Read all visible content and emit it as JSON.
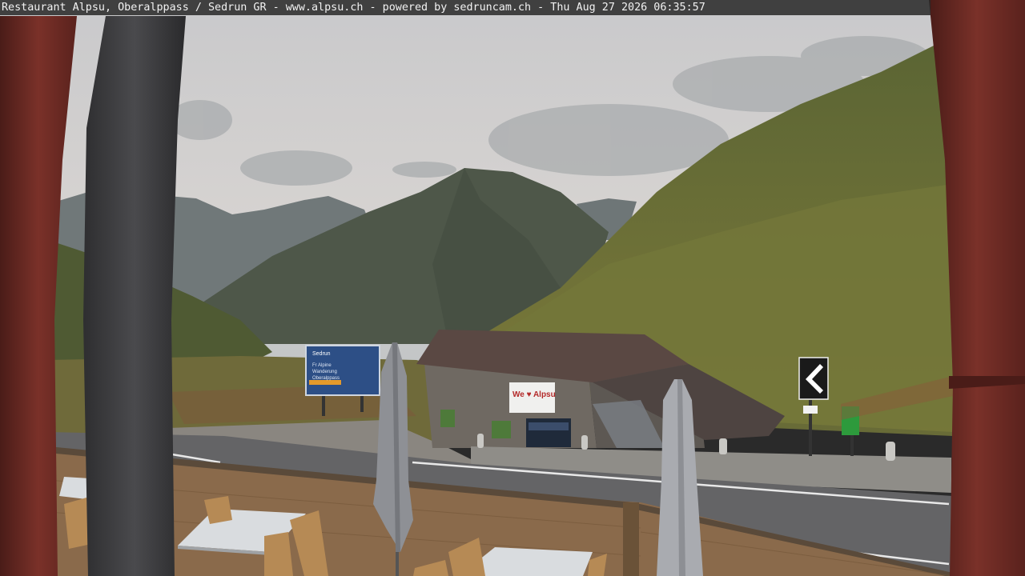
{
  "overlay": {
    "location": "Restaurant Alpsu, Oberalppass / Sedrun GR",
    "website": "www.alpsu.ch",
    "credit": "powered by sedruncam.ch",
    "timestamp": "Thu Aug 27 2026 06:35:57",
    "separator": " - "
  },
  "scene": {
    "building_sign": "We ♥ Alpsu",
    "billboard_title": "Sedrun",
    "billboard_lines": [
      "Fr Alpine",
      "Wanderung",
      "Oberalppass"
    ],
    "road_sign": "chevron-left-sign",
    "colors": {
      "sky": "#cfd0cf",
      "mountain_far": "#6c7475",
      "mountain_mid": "#4d5a47",
      "slope_green": "#6e7536",
      "frame_wood": "#6e2a24",
      "deck_wood": "#8b6a4c",
      "table": "#d9dcdf"
    }
  }
}
